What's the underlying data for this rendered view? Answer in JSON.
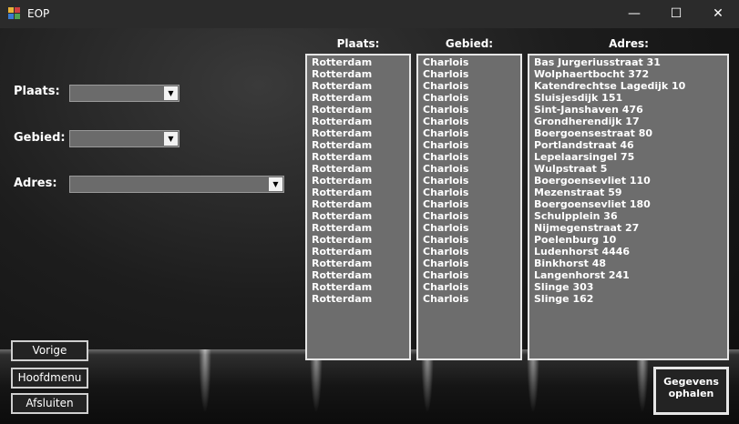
{
  "window": {
    "title": "EOP",
    "minimize": "—",
    "maximize": "☐",
    "close": "✕"
  },
  "form": {
    "plaats_label": "Plaats:",
    "gebied_label": "Gebied:",
    "adres_label": "Adres:",
    "plaats_value": "",
    "gebied_value": "",
    "adres_value": ""
  },
  "columns": {
    "plaats_header": "Plaats:",
    "gebied_header": "Gebied:",
    "adres_header": "Adres:"
  },
  "plaats_list": [
    "Rotterdam",
    "Rotterdam",
    "Rotterdam",
    "Rotterdam",
    "Rotterdam",
    "Rotterdam",
    "Rotterdam",
    "Rotterdam",
    "Rotterdam",
    "Rotterdam",
    "Rotterdam",
    "Rotterdam",
    "Rotterdam",
    "Rotterdam",
    "Rotterdam",
    "Rotterdam",
    "Rotterdam",
    "Rotterdam",
    "Rotterdam",
    "Rotterdam",
    "Rotterdam"
  ],
  "gebied_list": [
    "Charlois",
    "Charlois",
    "Charlois",
    "Charlois",
    "Charlois",
    "Charlois",
    "Charlois",
    "Charlois",
    "Charlois",
    "Charlois",
    "Charlois",
    "Charlois",
    "Charlois",
    "Charlois",
    "Charlois",
    "Charlois",
    "Charlois",
    "Charlois",
    "Charlois",
    "Charlois",
    "Charlois"
  ],
  "adres_list": [
    "Bas Jurgeriusstraat 31",
    "Wolphaertbocht 372",
    "Katendrechtse Lagedijk 10",
    "Sluisjesdijk 151",
    "Sint-Janshaven 476",
    "Grondherendijk 17",
    "Boergoensestraat 80",
    "Portlandstraat 46",
    "Lepelaarsingel 75",
    "Wulpstraat 5",
    "Boergoensevliet 110",
    "Mezenstraat 59",
    "Boergoensevliet 180",
    "Schulpplein 36",
    "Nijmegenstraat 27",
    "Poelenburg 10",
    "Ludenhorst 4446",
    "Binkhorst 48",
    "Langenhorst 241",
    "Slinge 303",
    "Slinge 162"
  ],
  "buttons": {
    "vorige": "Vorige",
    "hoofdmenu": "Hoofdmenu",
    "afsluiten": "Afsluiten",
    "gegevens_line1": "Gegevens",
    "gegevens_line2": "ophalen"
  }
}
